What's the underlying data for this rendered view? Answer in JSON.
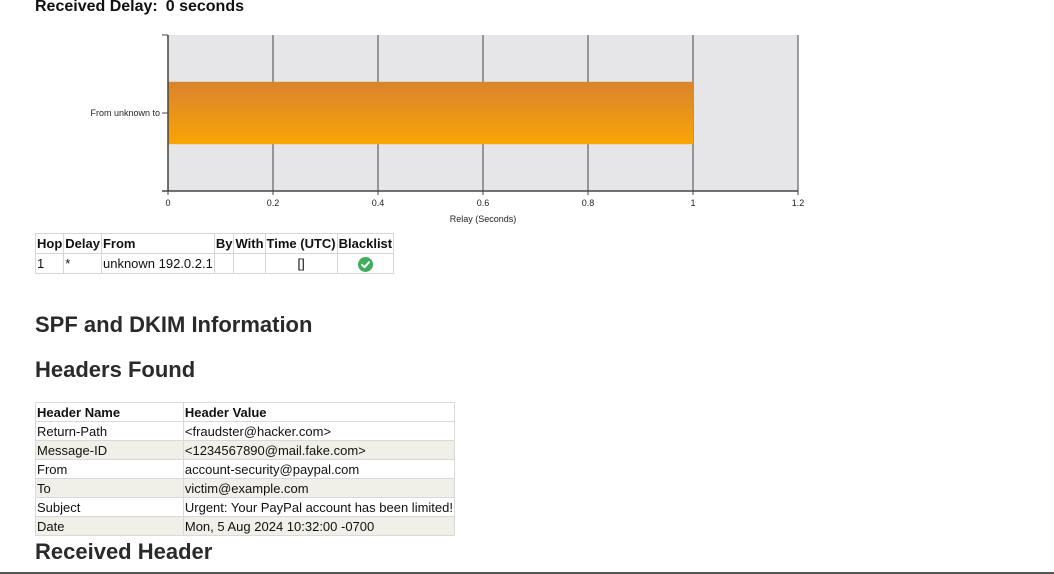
{
  "received_delay": {
    "label": "Received Delay:",
    "value": "0 seconds"
  },
  "chart_data": {
    "type": "bar",
    "orientation": "horizontal",
    "categories": [
      "From unknown to"
    ],
    "values": [
      1
    ],
    "xlabel": "Relay (Seconds)",
    "xlim": [
      0,
      1.2
    ],
    "xticks": [
      "0",
      "0.2",
      "0.4",
      "0.6",
      "0.8",
      "1",
      "1.2"
    ],
    "grid": true,
    "bar_color": "#f5a00a",
    "background": "#e6e6e8"
  },
  "hop_table": {
    "headers": [
      "Hop",
      "Delay",
      "From",
      "By",
      "With",
      "Time (UTC)",
      "Blacklist"
    ],
    "rows": [
      {
        "hop": "1",
        "delay": "*",
        "from": "unknown 192.0.2.1",
        "by": "",
        "with": "",
        "time": "[]",
        "blacklist_icon": "check-circle-icon"
      }
    ]
  },
  "sections": {
    "spf_dkim": "SPF and DKIM Information",
    "headers_found": "Headers Found",
    "received_header": "Received Header"
  },
  "headers_table": {
    "col_name": "Header Name",
    "col_value": "Header Value",
    "rows": [
      {
        "name": "Return-Path",
        "value": "<fraudster@hacker.com>"
      },
      {
        "name": "Message-ID",
        "value": "<1234567890@mail.fake.com>"
      },
      {
        "name": "From",
        "value": "account-security@paypal.com"
      },
      {
        "name": "To",
        "value": "victim@example.com"
      },
      {
        "name": "Subject",
        "value": "Urgent: Your PayPal account has been limited!"
      },
      {
        "name": "Date",
        "value": "Mon, 5 Aug 2024 10:32:00 -0700"
      }
    ]
  }
}
